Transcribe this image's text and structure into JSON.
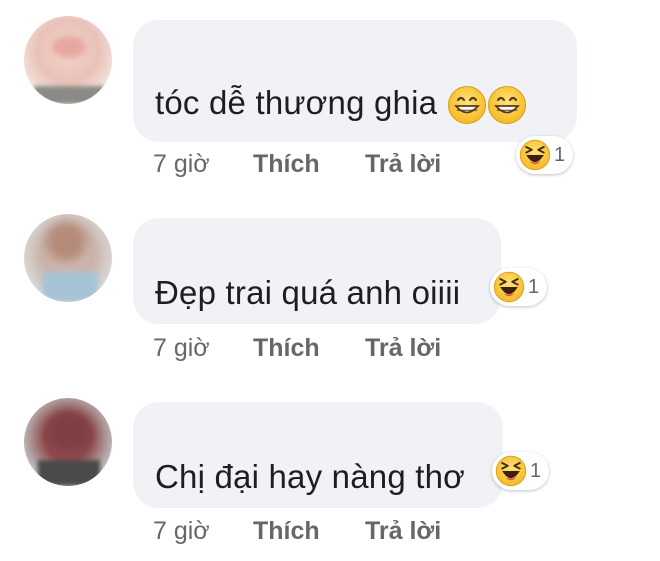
{
  "colors": {
    "bubble": "#f0f2f5",
    "text": "#1c1e21",
    "meta": "#65676b",
    "emoji_face": "#f7c136"
  },
  "comments": [
    {
      "text": "tóc dễ thương ghia",
      "inline_emojis": [
        "grinning-face-icon",
        "grinning-face-icon"
      ],
      "time": "7 giờ",
      "like_label": "Thích",
      "reply_label": "Trả lời",
      "reaction_icon": "laughing-face-icon",
      "reaction_count": "1"
    },
    {
      "text": "Đẹp trai quá anh oiiii",
      "inline_emojis": [],
      "time": "7 giờ",
      "like_label": "Thích",
      "reply_label": "Trả lời",
      "reaction_icon": "laughing-face-icon",
      "reaction_count": "1"
    },
    {
      "text": "Chị đại hay nàng thơ",
      "inline_emojis": [],
      "time": "7 giờ",
      "like_label": "Thích",
      "reply_label": "Trả lời",
      "reaction_icon": "laughing-face-icon",
      "reaction_count": "1"
    }
  ]
}
